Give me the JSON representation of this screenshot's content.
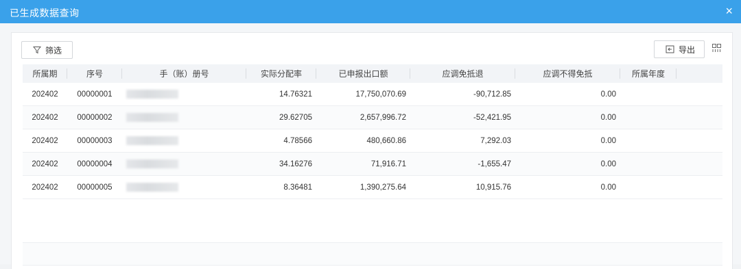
{
  "dialog": {
    "title": "已生成数据查询",
    "close_glyph": "×"
  },
  "toolbar": {
    "filter_label": "筛选",
    "export_label": "导出"
  },
  "table": {
    "headers": [
      "所属期",
      "序号",
      "手（账）册号",
      "实际分配率",
      "已申报出口额",
      "应调免抵退",
      "应调不得免抵",
      "所属年度"
    ],
    "rows": [
      [
        "202402",
        "00000001",
        "",
        "14.76321",
        "17,750,070.69",
        "-90,712.85",
        "0.00",
        ""
      ],
      [
        "202402",
        "00000002",
        "",
        "29.62705",
        "2,657,996.72",
        "-52,421.95",
        "0.00",
        ""
      ],
      [
        "202402",
        "00000003",
        "",
        "4.78566",
        "480,660.86",
        "7,292.03",
        "0.00",
        ""
      ],
      [
        "202402",
        "00000004",
        "",
        "34.16276",
        "71,916.71",
        "-1,655.47",
        "0.00",
        ""
      ],
      [
        "202402",
        "00000005",
        "",
        "8.36481",
        "1,390,275.64",
        "10,915.76",
        "0.00",
        ""
      ]
    ]
  }
}
